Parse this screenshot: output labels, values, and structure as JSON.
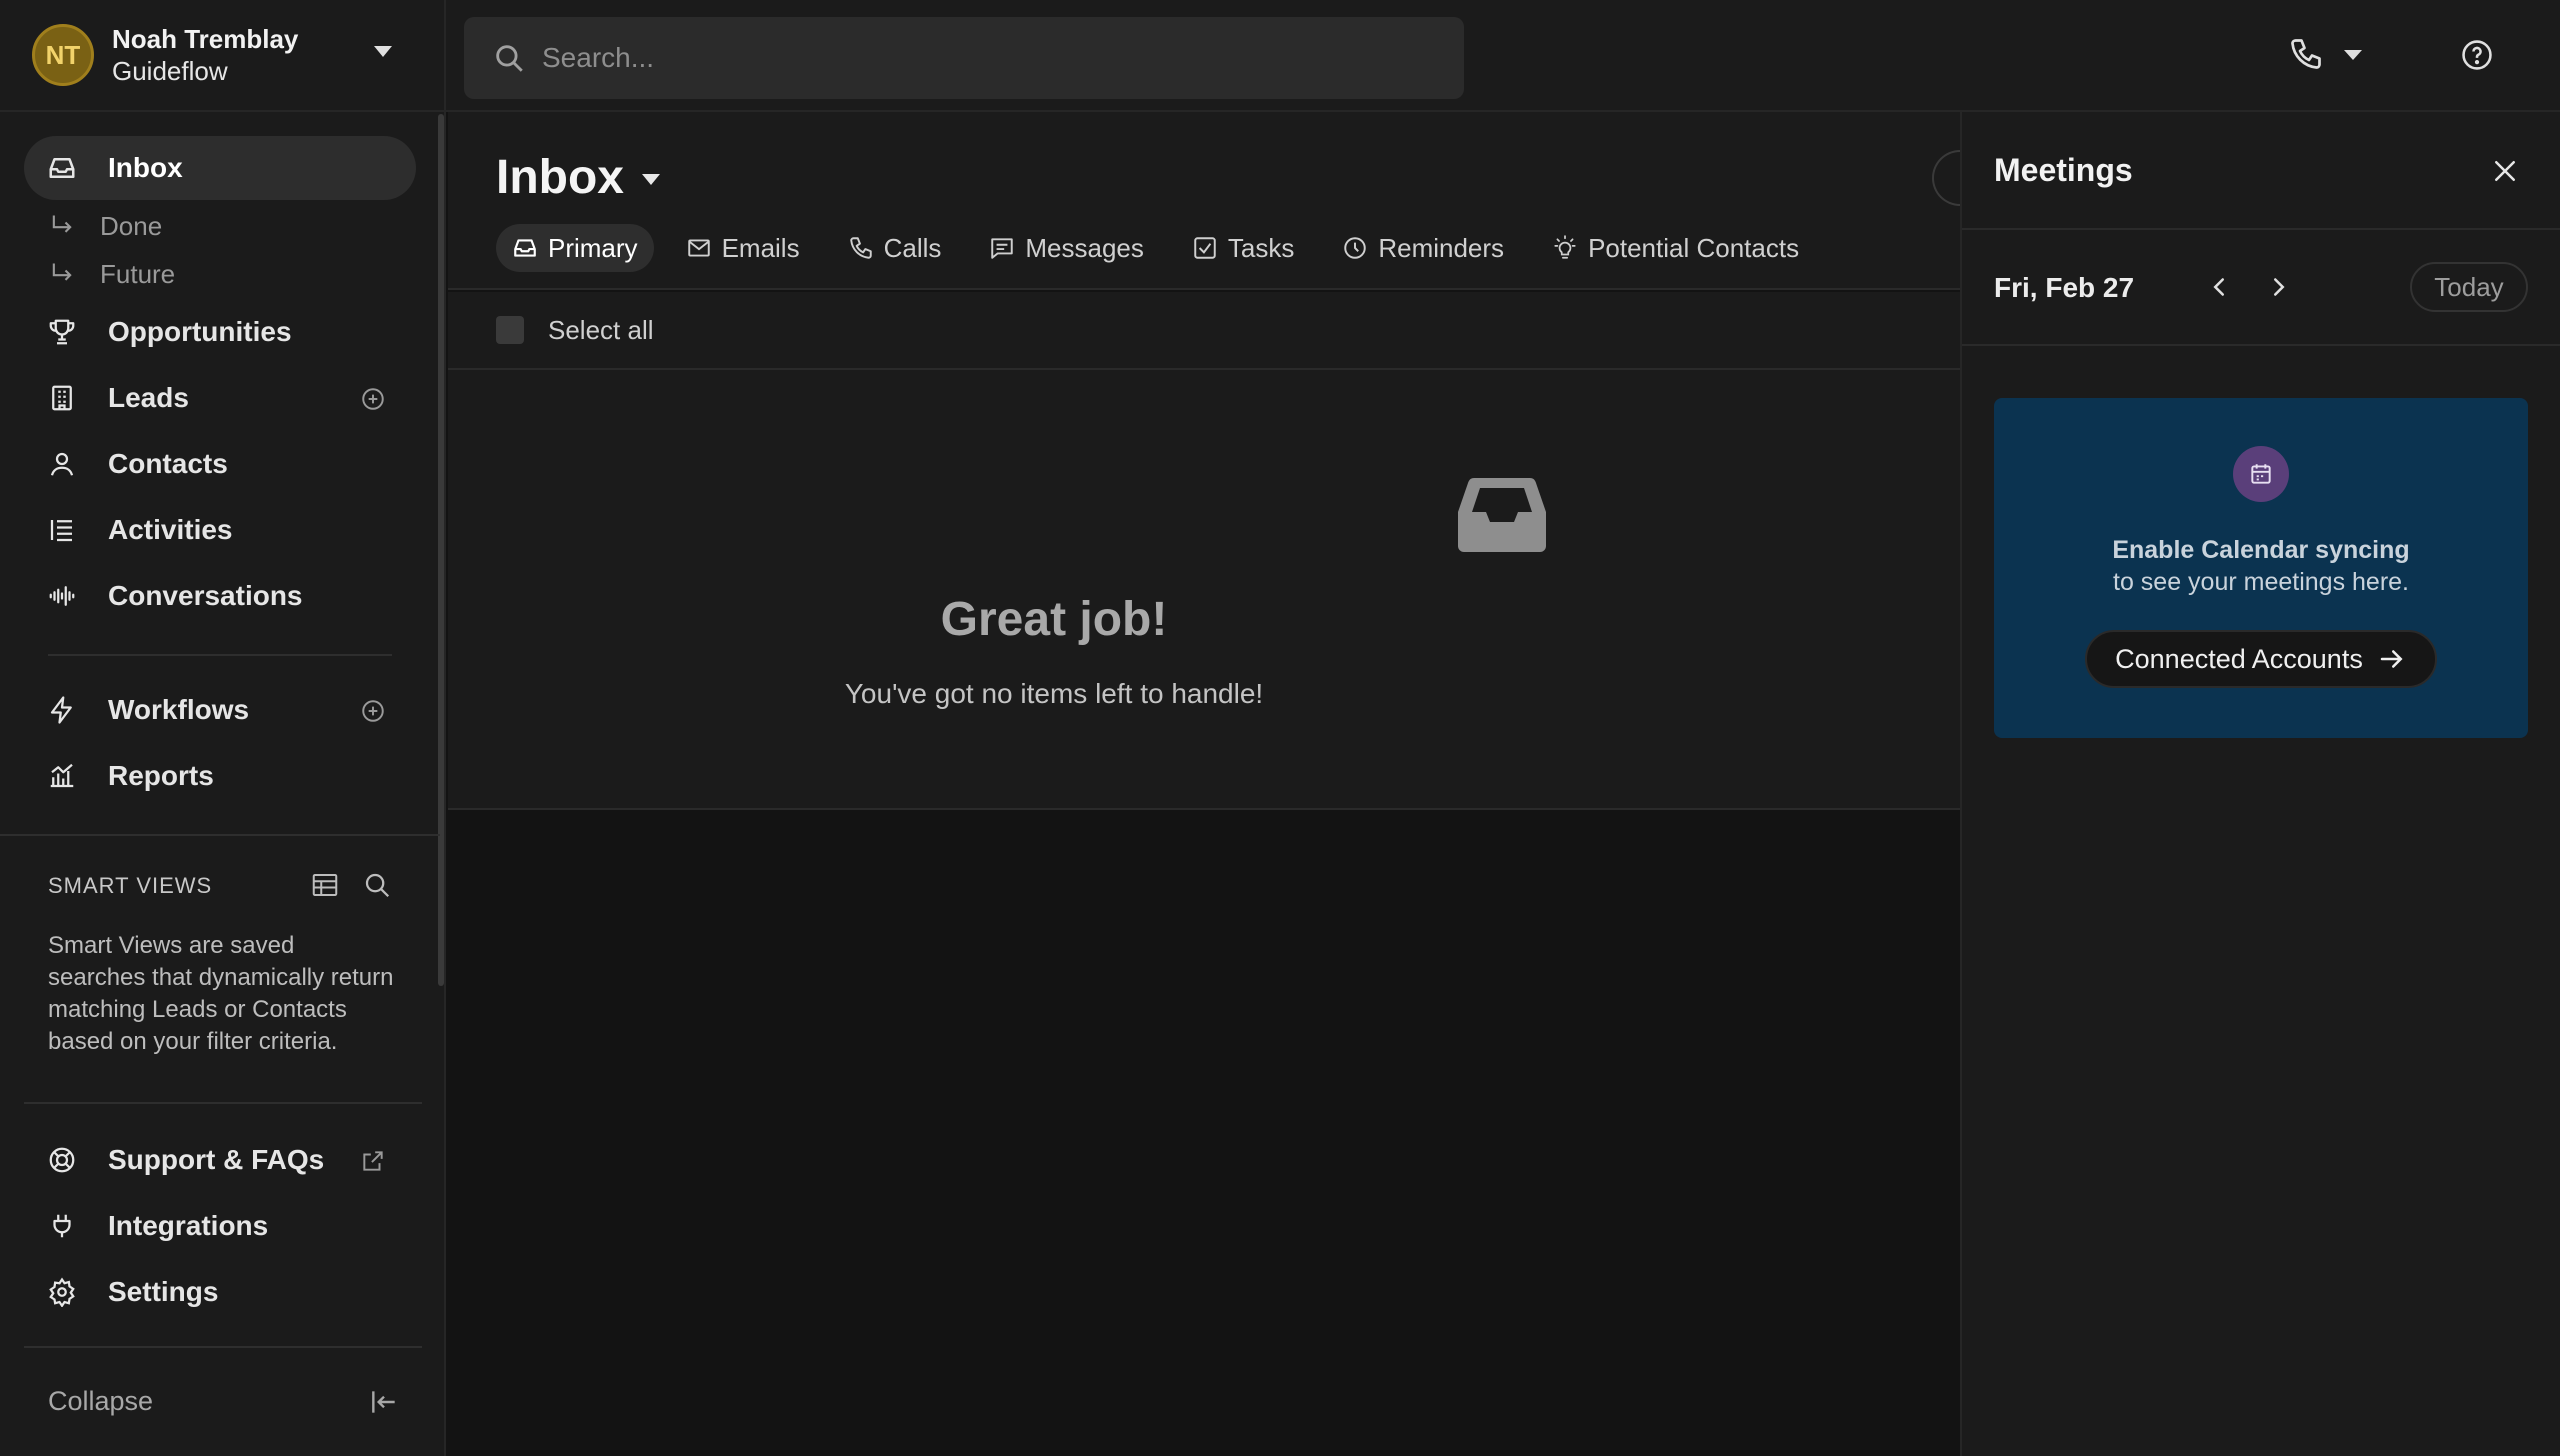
{
  "user": {
    "initials": "NT",
    "name": "Noah Tremblay",
    "org": "Guideflow"
  },
  "search": {
    "placeholder": "Search..."
  },
  "sidebar": {
    "items": [
      {
        "label": "Inbox"
      },
      {
        "label": "Opportunities"
      },
      {
        "label": "Leads"
      },
      {
        "label": "Contacts"
      },
      {
        "label": "Activities"
      },
      {
        "label": "Conversations"
      },
      {
        "label": "Workflows"
      },
      {
        "label": "Reports"
      }
    ],
    "inbox_sub": [
      {
        "label": "Done"
      },
      {
        "label": "Future"
      }
    ],
    "smart_views": {
      "title": "SMART VIEWS",
      "description": "Smart Views are saved searches that dynamically return matching Leads or Contacts based on your filter criteria."
    },
    "bottom": [
      {
        "label": "Support & FAQs"
      },
      {
        "label": "Integrations"
      },
      {
        "label": "Settings"
      }
    ],
    "collapse": "Collapse"
  },
  "inbox": {
    "title": "Inbox",
    "tabs": [
      {
        "label": "Primary",
        "icon": "inbox-icon"
      },
      {
        "label": "Emails",
        "icon": "mail-icon"
      },
      {
        "label": "Calls",
        "icon": "phone-icon"
      },
      {
        "label": "Messages",
        "icon": "message-icon"
      },
      {
        "label": "Tasks",
        "icon": "checkbox-icon"
      },
      {
        "label": "Reminders",
        "icon": "clock-icon"
      },
      {
        "label": "Potential Contacts",
        "icon": "lightbulb-icon"
      }
    ],
    "select_all": "Select all",
    "empty_title": "Great job!",
    "empty_sub": "You've got no items left to handle!"
  },
  "meetings": {
    "title": "Meetings",
    "date": "Fri, Feb 27",
    "today": "Today",
    "card_line1": "Enable Calendar syncing",
    "card_line2": "to see your meetings here.",
    "button": "Connected Accounts"
  },
  "colors": {
    "accent_card": "#0b3350",
    "avatar": "#7a6114",
    "badge": "#5a3f7a"
  }
}
